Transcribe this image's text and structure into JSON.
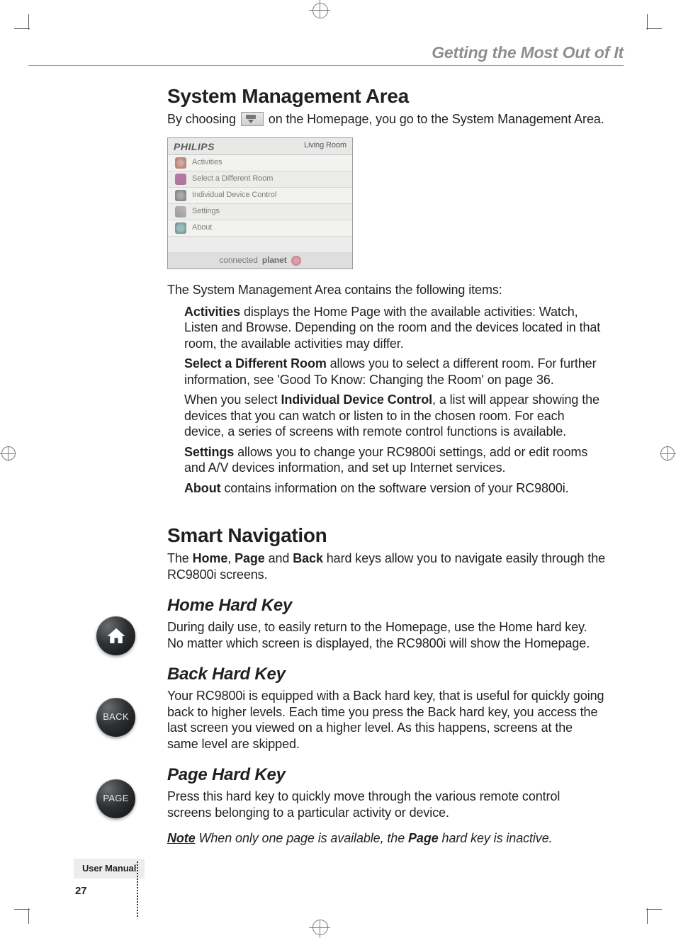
{
  "running_header": "Getting the Most Out of It",
  "section1": {
    "title": "System Management Area",
    "intro_before_icon": "By choosing",
    "intro_after_icon": "on the Homepage, you go to the System Management Area.",
    "after_shot": "The System Management Area contains the following items:",
    "items": {
      "activities_label": "Activities",
      "activities_text": " displays the Home Page with the available activities: Watch, Listen and Browse. Depending on the room and the devices located in that room, the available activities may differ.",
      "select_room_label": "Select a Different Room",
      "select_room_text": " allows you to select a different room. For further information, see 'Good To Know: Changing the Room' on page 36.",
      "idc_before": "When you select ",
      "idc_label": "Individual Device Control",
      "idc_after": ", a list will appear showing the devices that you can watch or listen to in the chosen room. For each device, a series of screens with remote control functions is available.",
      "settings_label": "Settings",
      "settings_text": " allows you to change your RC9800i settings, add or edit rooms and A/V devices information, and set up Internet services.",
      "about_label": "About",
      "about_text": " contains information on the software version of your RC9800i."
    }
  },
  "device_shot": {
    "brand": "PHILIPS",
    "room": "Living Room",
    "rows": [
      "Activities",
      "Select a Different Room",
      "Individual Device Control",
      "Settings",
      "About"
    ],
    "bottom": {
      "left": "connected",
      "bold": "planet"
    }
  },
  "section2": {
    "title": "Smart Navigation",
    "intro_parts": [
      "The ",
      "Home",
      ", ",
      "Page",
      " and ",
      "Back",
      " hard keys allow you to navigate easily through the RC9800i screens."
    ]
  },
  "home_key": {
    "title": "Home Hard Key",
    "text": "During daily use, to easily return to the Homepage, use the Home hard key. No matter which screen is displayed, the RC9800i will show the Homepage."
  },
  "back_key": {
    "title": "Back Hard Key",
    "label": "BACK",
    "text": "Your RC9800i is equipped with a Back hard key, that is useful for quickly going back to higher levels. Each time you press the Back hard key, you access the last screen you viewed on a higher level. As this happens, screens at the same level are skipped."
  },
  "page_key": {
    "title": "Page Hard Key",
    "label": "PAGE",
    "text": "Press this hard key to quickly move through the various remote control screens belonging to a particular activity or device."
  },
  "note": {
    "label": "Note",
    "before": " When only one page is available, the ",
    "bold": "Page",
    "after": " hard key is inactive."
  },
  "footer": {
    "label": "User Manual",
    "page": "27"
  }
}
